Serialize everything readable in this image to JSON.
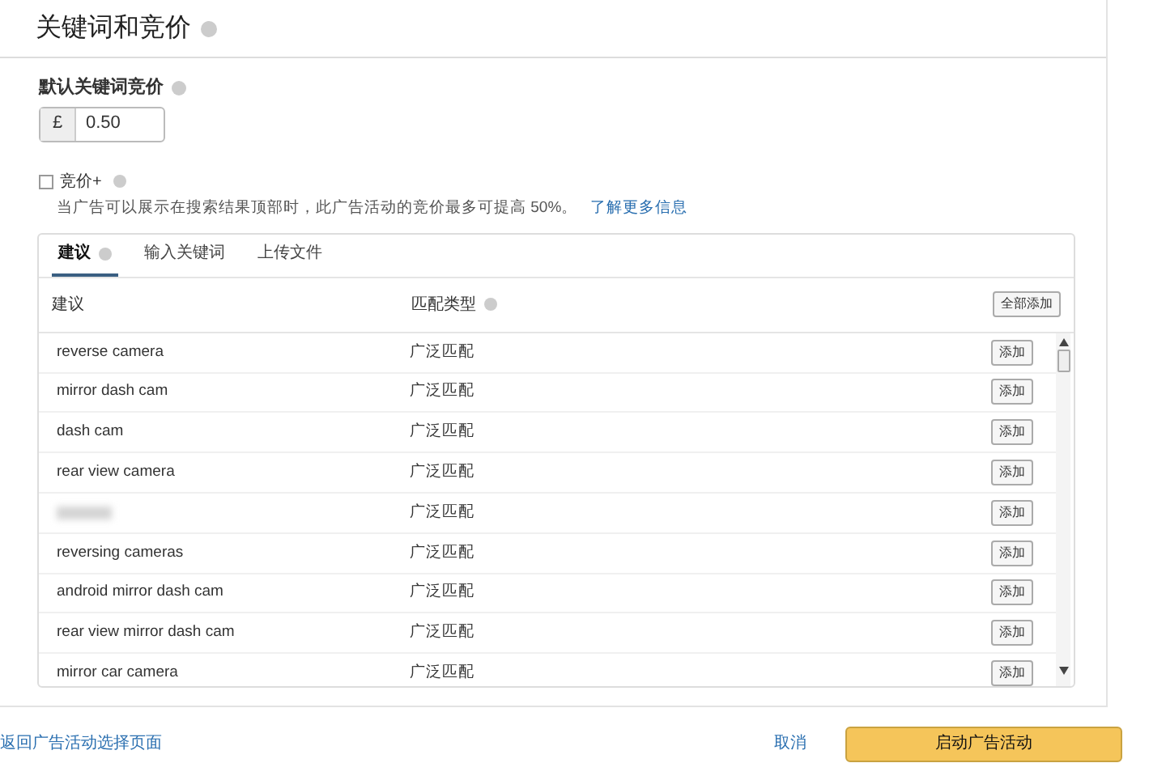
{
  "section": {
    "title": "关键词和竞价"
  },
  "default_bid": {
    "label": "默认关键词竞价",
    "currency": "£",
    "value": "0.50"
  },
  "bid_plus": {
    "label": "竞价+",
    "checked": false,
    "description": "当广告可以展示在搜索结果顶部时，此广告活动的竞价最多可提高 50%。",
    "link": "了解更多信息"
  },
  "tabs": [
    {
      "label": "建议",
      "selected": true,
      "info": true
    },
    {
      "label": "输入关键词",
      "selected": false,
      "info": false
    },
    {
      "label": "上传文件",
      "selected": false,
      "info": false
    }
  ],
  "table": {
    "columns": [
      "建议",
      "匹配类型"
    ],
    "add_all_button": "全部添加",
    "rows": [
      {
        "kind": "keyword",
        "keyword": "reverse camera",
        "match_type": "广泛匹配",
        "button": "添加"
      },
      {
        "kind": "keyword",
        "keyword": "mirror dash cam",
        "match_type": "广泛匹配",
        "button": "添加"
      },
      {
        "kind": "keyword",
        "keyword": "dash cam",
        "match_type": "广泛匹配",
        "button": "添加"
      },
      {
        "kind": "keyword",
        "keyword": "rear view camera",
        "match_type": "广泛匹配",
        "button": "添加"
      },
      {
        "kind": "redacted",
        "match_type": "广泛匹配",
        "button": "添加"
      },
      {
        "kind": "keyword",
        "keyword": "reversing cameras",
        "match_type": "广泛匹配",
        "button": "添加"
      },
      {
        "kind": "keyword",
        "keyword": "android mirror dash cam",
        "match_type": "广泛匹配",
        "button": "添加"
      },
      {
        "kind": "keyword",
        "keyword": "rear view mirror dash cam",
        "match_type": "广泛匹配",
        "button": "添加"
      },
      {
        "kind": "keyword",
        "keyword": "mirror car camera",
        "match_type": "广泛匹配",
        "button": "添加"
      }
    ]
  },
  "footer": {
    "back_link": "返回广告活动选择页面",
    "cancel": "取消",
    "launch": "启动广告活动"
  }
}
